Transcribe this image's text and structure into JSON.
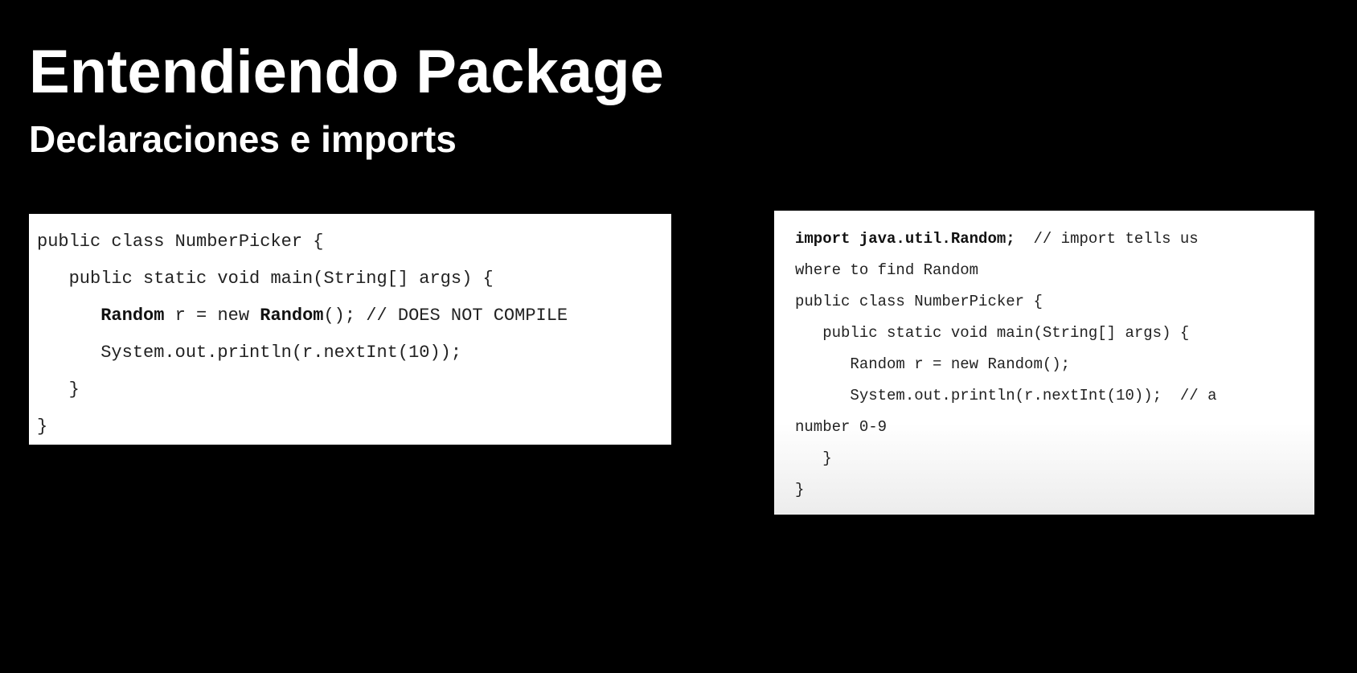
{
  "slide": {
    "title": "Entendiendo Package",
    "subtitle": "Declaraciones e imports"
  },
  "code_left": {
    "lines": [
      "public class NumberPicker {",
      "   public static void main(String[] args) {",
      "      Random r = new Random(); // DOES NOT COMPILE",
      "      System.out.println(r.nextInt(10));",
      "   }",
      "}"
    ],
    "bold_terms": [
      "Random"
    ]
  },
  "code_right": {
    "lines": [
      "import java.util.Random;  // import tells us",
      "where to find Random",
      "public class NumberPicker {",
      "   public static void main(String[] args) {",
      "      Random r = new Random();",
      "      System.out.println(r.nextInt(10));  // a",
      "number 0-9",
      "   }",
      "}"
    ],
    "bold_prefix": "import java.util.Random;"
  },
  "colors": {
    "background": "#000000",
    "text": "#ffffff",
    "code_panel": "#ffffff",
    "code_text": "#222222"
  }
}
